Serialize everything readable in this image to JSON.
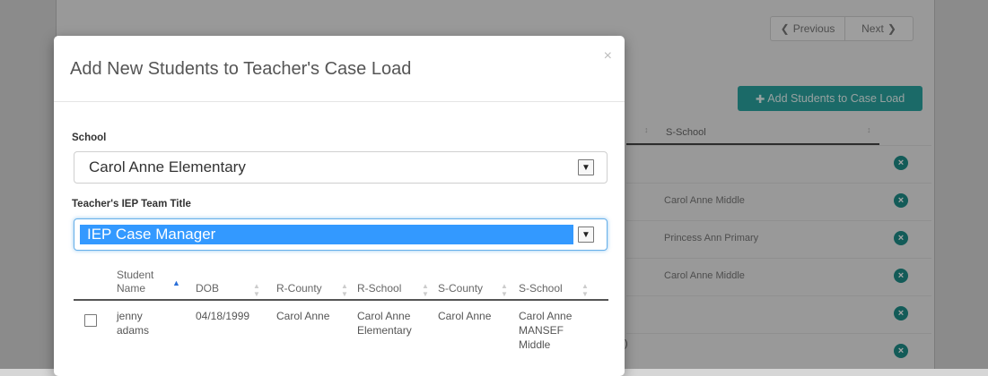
{
  "background": {
    "prev_label": "Previous",
    "next_label": "Next",
    "add_button_label": "Add Students to Case Load",
    "column_header": "S-School",
    "rows": [
      {
        "school": ""
      },
      {
        "school": "Carol Anne Middle"
      },
      {
        "school": "Princess Ann Primary"
      },
      {
        "school": "Carol Anne Middle"
      },
      {
        "school": ""
      },
      {
        "school": ""
      }
    ],
    "stub_text": ")"
  },
  "modal": {
    "title": "Add New Students to Teacher's Case Load",
    "close_glyph": "×",
    "school_label": "School",
    "school_value": "Carol Anne Elementary",
    "team_title_label": "Teacher's IEP Team Title",
    "team_title_value": "IEP Case Manager",
    "table": {
      "headers": [
        "Student Name",
        "DOB",
        "R-County",
        "R-School",
        "S-County",
        "S-School"
      ],
      "rows": [
        {
          "name": "jenny adams",
          "dob": "04/18/1999",
          "r_county": "Carol Anne",
          "r_school": "Carol Anne Elementary",
          "s_county": "Carol Anne",
          "s_school": "Carol Anne MANSEF Middle"
        }
      ]
    }
  },
  "colors": {
    "accent": "#2aa4a0",
    "focus": "#66afe9",
    "selection": "#3399ff",
    "remove_icon": "#1e8c88"
  }
}
